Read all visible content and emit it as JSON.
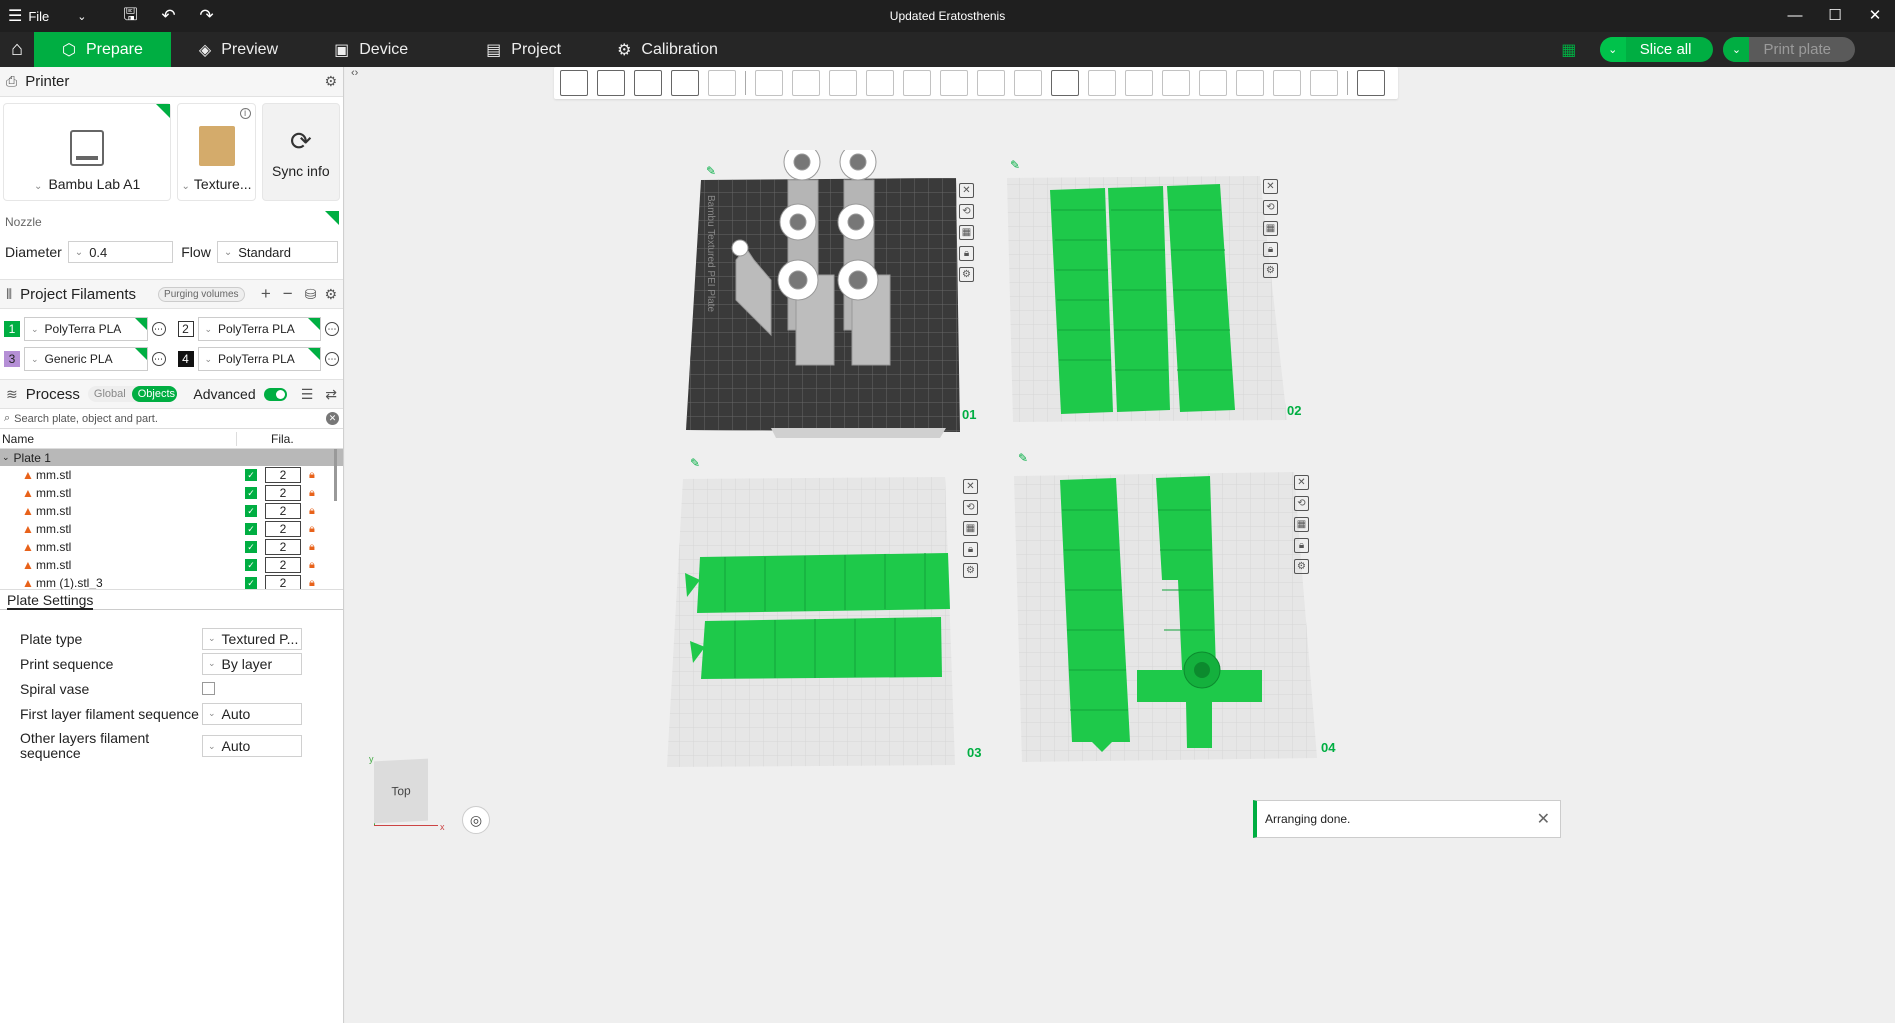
{
  "window": {
    "title": "Updated Eratosthenis",
    "menu_label": "File"
  },
  "tabs": [
    {
      "label": "Prepare",
      "icon": "cube-icon"
    },
    {
      "label": "Preview",
      "icon": "layers-icon"
    },
    {
      "label": "Device",
      "icon": "device-icon"
    },
    {
      "label": "Project",
      "icon": "project-icon"
    },
    {
      "label": "Calibration",
      "icon": "calibration-icon"
    }
  ],
  "actions": {
    "slice_all": "Slice all",
    "print_plate": "Print plate"
  },
  "printer": {
    "section": "Printer",
    "name": "Bambu Lab A1",
    "plate": "Texture...",
    "sync": "Sync info"
  },
  "nozzle": {
    "label": "Nozzle",
    "diameter_label": "Diameter",
    "diameter_value": "0.4",
    "flow_label": "Flow",
    "flow_value": "Standard"
  },
  "filaments": {
    "section": "Project Filaments",
    "purging": "Purging volumes",
    "items": [
      {
        "num": "1",
        "name": "PolyTerra PLA",
        "color": "#00ae42"
      },
      {
        "num": "2",
        "name": "PolyTerra PLA",
        "color": "#ffffff"
      },
      {
        "num": "3",
        "name": "Generic PLA",
        "color": "#b58fd6"
      },
      {
        "num": "4",
        "name": "PolyTerra PLA",
        "color": "#111111"
      }
    ]
  },
  "process": {
    "section": "Process",
    "global": "Global",
    "objects": "Objects",
    "advanced": "Advanced",
    "search_placeholder": "Search plate, object and part.",
    "col_name": "Name",
    "col_fila": "Fila.",
    "plate": "Plate 1",
    "rows": [
      {
        "name": "mm.stl",
        "fila": "2"
      },
      {
        "name": "mm.stl",
        "fila": "2"
      },
      {
        "name": "mm.stl",
        "fila": "2"
      },
      {
        "name": "mm.stl",
        "fila": "2"
      },
      {
        "name": "mm.stl",
        "fila": "2"
      },
      {
        "name": "mm.stl",
        "fila": "2"
      },
      {
        "name": "mm (1).stl_3",
        "fila": "2"
      }
    ]
  },
  "plate_settings": {
    "title": "Plate Settings",
    "plate_type_label": "Plate type",
    "plate_type_value": "Textured P...",
    "print_sequence_label": "Print sequence",
    "print_sequence_value": "By layer",
    "spiral_vase_label": "Spiral vase",
    "first_layer_label": "First layer filament sequence",
    "first_layer_value": "Auto",
    "other_layers_label": "Other layers filament sequence",
    "other_layers_value": "Auto"
  },
  "plates": [
    {
      "num": "01",
      "label": "Bambu Textured PEI Plate"
    },
    {
      "num": "02"
    },
    {
      "num": "03"
    },
    {
      "num": "04"
    }
  ],
  "view": {
    "cube_label": "Top",
    "axis_x": "x",
    "axis_y": "y"
  },
  "toast": {
    "message": "Arranging done."
  },
  "colors": {
    "accent": "#00ae42",
    "bed_dark": "#3a3a3a",
    "model_green": "#1ec94a"
  }
}
